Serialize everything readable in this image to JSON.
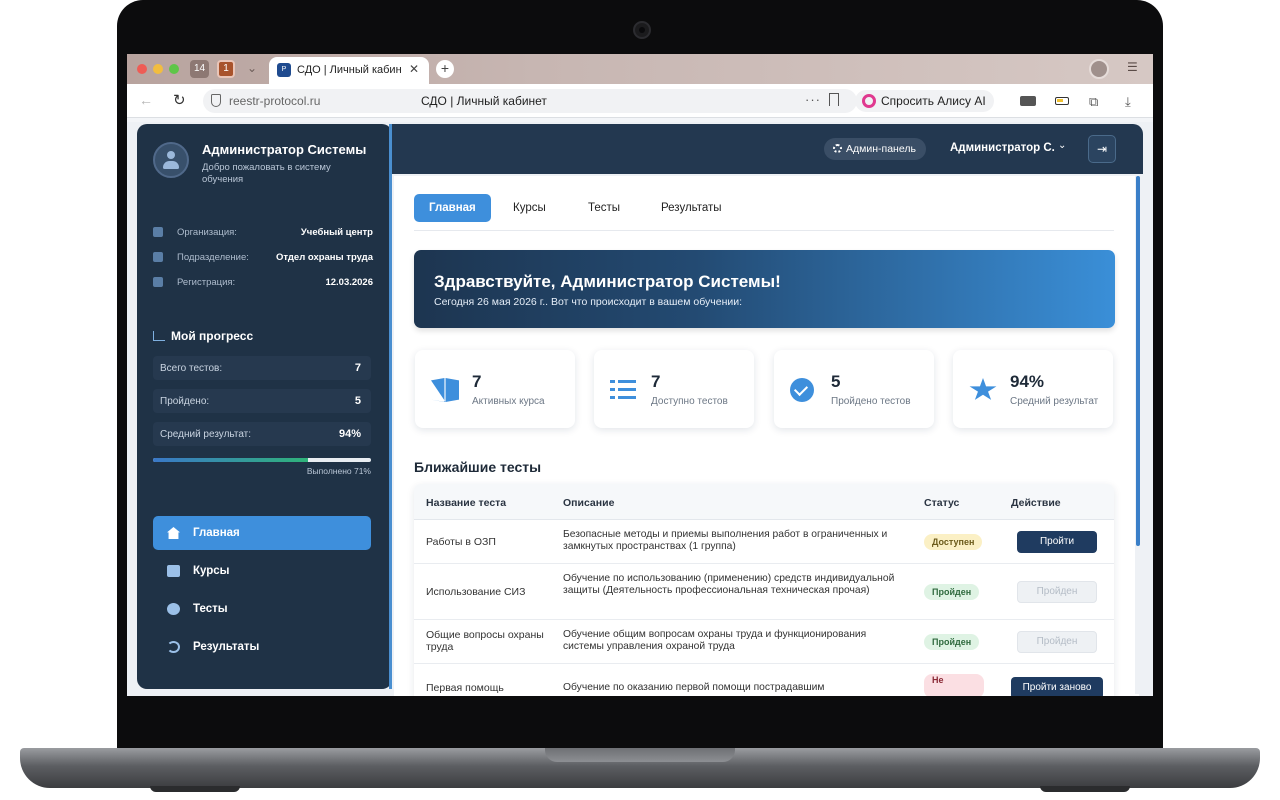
{
  "browser": {
    "tab_count": "14",
    "tab_count_2": "1",
    "tab_title": "СДО | Личный кабинет",
    "favicon_text": "P",
    "url": "reestr-protocol.ru",
    "page_title": "СДО | Личный кабинет",
    "alice_label": "Спросить Алису AI"
  },
  "sidebar": {
    "user_name": "Администратор Системы",
    "welcome": "Добро пожаловать в систему обучения",
    "info": [
      {
        "label": "Организация:",
        "value": "Учебный центр",
        "icon": "building-icon"
      },
      {
        "label": "Подразделение:",
        "value": "Отдел охраны труда",
        "icon": "users-icon"
      },
      {
        "label": "Регистрация:",
        "value": "12.03.2026",
        "icon": "calendar-icon"
      }
    ],
    "progress_title": "Мой прогресс",
    "stats": [
      {
        "label": "Всего тестов:",
        "value": "7"
      },
      {
        "label": "Пройдено:",
        "value": "5"
      },
      {
        "label": "Средний результат:",
        "value": "94%"
      }
    ],
    "progress_percent": 71,
    "progress_caption": "Выполнено 71%",
    "nav": [
      {
        "label": "Главная",
        "icon": "home-icon",
        "active": true
      },
      {
        "label": "Курсы",
        "icon": "book-icon",
        "active": false
      },
      {
        "label": "Тесты",
        "icon": "help-icon",
        "active": false
      },
      {
        "label": "Результаты",
        "icon": "history-icon",
        "active": false
      }
    ]
  },
  "header": {
    "admin_panel_label": "Админ-панель",
    "admin_name": "Администратор С."
  },
  "main": {
    "tabs": [
      {
        "label": "Главная",
        "active": true
      },
      {
        "label": "Курсы",
        "active": false
      },
      {
        "label": "Тесты",
        "active": false
      },
      {
        "label": "Результаты",
        "active": false
      }
    ],
    "banner_title": "Здравствуйте, Администратор Системы!",
    "banner_subtitle": "Сегодня 26 мая 2026 г.. Вот что происходит в вашем обучении:",
    "cards": [
      {
        "value": "7",
        "label": "Активных курса",
        "icon": "open-book-icon"
      },
      {
        "value": "7",
        "label": "Доступно тестов",
        "icon": "checklist-icon"
      },
      {
        "value": "5",
        "label": "Пройдено тестов",
        "icon": "check-circle-icon"
      },
      {
        "value": "94%",
        "label": "Средний результат",
        "icon": "star-icon"
      }
    ],
    "section_title": "Ближайшие тесты",
    "table": {
      "headers": [
        "Название теста",
        "Описание",
        "Статус",
        "Действие"
      ],
      "rows": [
        {
          "name": "Работы в ОЗП",
          "description": "Безопасные методы и приемы выполнения работ в ограниченных и замкнутых пространствах (1 группа)",
          "status": "Доступен",
          "action": "Пройти"
        },
        {
          "name": "Использование СИЗ",
          "description": "Обучение по использованию (применению) средств индивидуальной защиты (Деятельность профессиональная техническая прочая)",
          "status": "Пройден",
          "action": "Пройден"
        },
        {
          "name": "Общие вопросы охраны труда",
          "description": "Обучение общим вопросам охраны труда и функционирования системы управления охраной труда",
          "status": "Пройден",
          "action": "Пройден"
        },
        {
          "name": "Первая помощь",
          "description": "Обучение по оказанию первой помощи пострадавшим",
          "status": "Не",
          "action": "Пройти заново"
        }
      ]
    }
  },
  "colors": {
    "sidebar_bg": "#1f3246",
    "accent": "#3e8fdc",
    "primary_button": "#1f3b60"
  }
}
